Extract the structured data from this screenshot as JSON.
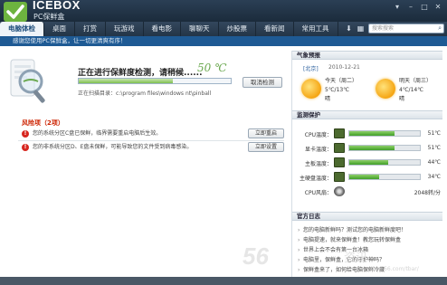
{
  "app": {
    "name": "ICEBOX",
    "subtitle": "PC保鲜盒",
    "controls": [
      "▾",
      "–",
      "□",
      "✕"
    ]
  },
  "nav": {
    "tabs": [
      "电脑体检",
      "桌面",
      "打赏",
      "玩游戏",
      "看电影",
      "聊聊天",
      "炒股票",
      "看新闻",
      "常用工具"
    ],
    "active_index": 0,
    "search_placeholder": "搜索搜索"
  },
  "notice": "感谢您使用PC保鲜盒，让一切更清爽有序！",
  "scan": {
    "title": "正在进行保鲜度检测，请稍候......",
    "temperature": "50 ℃",
    "progress": 0.62,
    "cancel_label": "取消检测",
    "path": "正在扫描目录：c:\\program files\\windows nt\\pinball"
  },
  "risks": {
    "heading": "风险项（2项）",
    "items": [
      {
        "text": "您的系统分区C盘已保鲜，临界需要重启电脑后生效。",
        "action": "立即重启"
      },
      {
        "text": "您的非系统分区D、E盘未保鲜，可能导致您的文件受到病毒感染。",
        "action": "立即设置"
      }
    ]
  },
  "weather": {
    "heading": "气象预报",
    "link": "[北京]",
    "date": "2010-12-21",
    "days": [
      {
        "name": "今天（周二）",
        "temp": "5℃/13℃",
        "desc": "晴",
        "icon": "sun-icon"
      },
      {
        "name": "明天（周三）",
        "temp": "4℃/14℃",
        "desc": "晴",
        "icon": "sun-icon"
      }
    ]
  },
  "monitor": {
    "heading": "监测保护",
    "items": [
      {
        "label": "CPU温度：",
        "value": "51℃",
        "level": 0.64
      },
      {
        "label": "显卡温度：",
        "value": "51℃",
        "level": 0.64
      },
      {
        "label": "主板温度：",
        "value": "44℃",
        "level": 0.55
      },
      {
        "label": "主硬盘温度：",
        "value": "34℃",
        "level": 0.42
      }
    ],
    "fan": {
      "label": "CPU风扇：",
      "value": "2048转/分"
    }
  },
  "news": {
    "heading": "官方日志",
    "items": [
      "您的电脑新鲜吗？测试您的电脑新鲜度吧！",
      "电脑提速，就来保鲜盒！教您玩转保鲜盒",
      "世界上会不会有第一台冰箱",
      "电脑里，保鲜盒，它的守护神吗？",
      "保鲜盒来了，如何给电脑保鲜冷藏"
    ]
  },
  "watermark": {
    "big": "56",
    "cn": "资讯",
    "url": "www.56.com/tbar/"
  },
  "colors": {
    "nav_bg": "#2b3f55",
    "notice_bg": "#1e5a94",
    "accent_green": "#6aa84f",
    "risk_red": "#cc2200"
  }
}
